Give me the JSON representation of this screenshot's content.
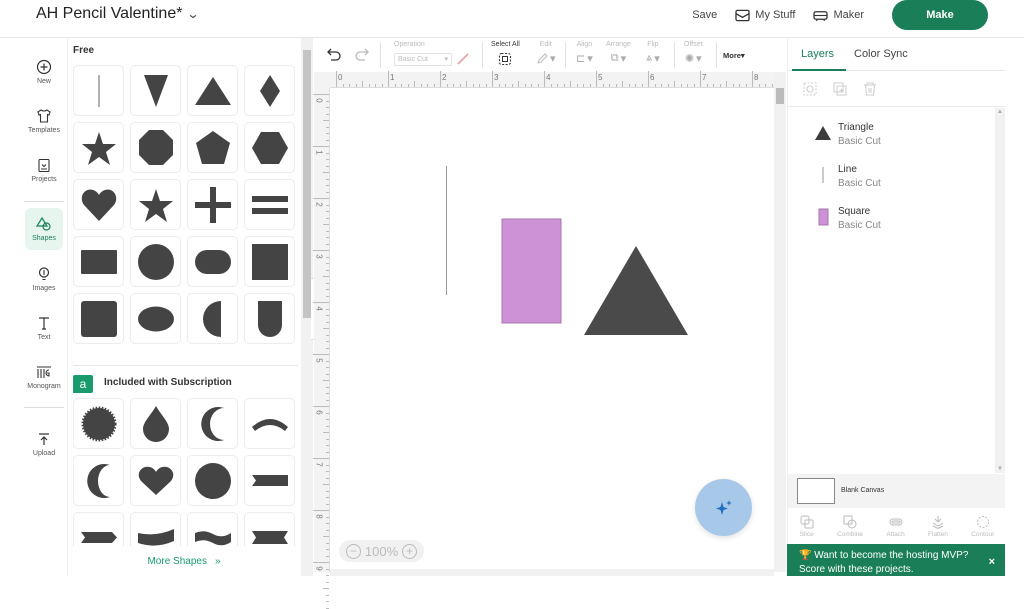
{
  "header": {
    "project_title": "AH Pencil Valentine*",
    "save_label": "Save",
    "my_stuff_label": "My Stuff",
    "maker_label": "Maker",
    "make_label": "Make"
  },
  "leftnav": {
    "items": [
      {
        "label": "New",
        "icon": "plus-circle-icon"
      },
      {
        "label": "Templates",
        "icon": "tshirt-icon"
      },
      {
        "label": "Projects",
        "icon": "projects-icon"
      },
      {
        "label": "Shapes",
        "icon": "shapes-icon",
        "active": true
      },
      {
        "label": "Images",
        "icon": "lightbulb-icon"
      },
      {
        "label": "Text",
        "icon": "text-icon"
      },
      {
        "label": "Monogram",
        "icon": "monogram-icon"
      },
      {
        "label": "Upload",
        "icon": "upload-icon"
      }
    ]
  },
  "shapes_panel": {
    "free_title": "Free",
    "free_shapes": [
      "Line",
      "Inverted Triangle",
      "Triangle",
      "Diamond",
      "Star",
      "Octagon",
      "Pentagon",
      "Hexagon",
      "Heart",
      "Star Small",
      "Plus",
      "Equals",
      "Rectangle",
      "Circle",
      "Rounded Rectangle",
      "Square",
      "Rounded Square",
      "Oval",
      "Half Circle",
      "Shield"
    ],
    "subscription_badge": "a",
    "subscription_title": "Included with Subscription",
    "subscription_shapes": [
      "Seal",
      "Teardrop",
      "Crescent",
      "Arc Banner",
      "Crescent Thin",
      "Heart",
      "Scalloped Circle",
      "Banner",
      "Arrow Banner",
      "Wavy Banner",
      "Wavy Banner 2",
      "Ribbon"
    ],
    "more_shapes_label": "More Shapes",
    "more_shapes_icon": "»"
  },
  "toolbar": {
    "operation_label": "Operation",
    "operation_value": "Basic Cut",
    "select_all_label": "Select All",
    "edit_label": "Edit",
    "align_label": "Align",
    "arrange_label": "Arrange",
    "flip_label": "Flip",
    "offset_label": "Offset",
    "more_label": "More"
  },
  "ruler": {
    "h_labels": [
      "0",
      "1",
      "2",
      "3",
      "4",
      "5",
      "6",
      "7",
      "8"
    ],
    "v_labels": [
      "0",
      "1",
      "2",
      "3",
      "4",
      "5",
      "6",
      "7",
      "8",
      "9"
    ]
  },
  "canvas": {
    "zoom_level": "100%",
    "objects": [
      {
        "name": "Line",
        "color": "#999999"
      },
      {
        "name": "Square",
        "color": "#cd92d6"
      },
      {
        "name": "Triangle",
        "color": "#4a4a4a"
      }
    ]
  },
  "right_panel": {
    "tabs": [
      "Layers",
      "Color Sync"
    ],
    "active_tab": "Layers",
    "layers": [
      {
        "name": "Triangle",
        "operation": "Basic Cut",
        "color": "#3d3d3d"
      },
      {
        "name": "Line",
        "operation": "Basic Cut",
        "color": "#999999"
      },
      {
        "name": "Square",
        "operation": "Basic Cut",
        "color": "#cd92d6"
      }
    ],
    "blank_canvas_label": "Blank Canvas",
    "bottom_tools": [
      "Slice",
      "Combine",
      "Attach",
      "Flatten",
      "Contour"
    ]
  },
  "promo": {
    "icon": "🏆",
    "line1": "Want to become the hosting MVP?",
    "line2": "Score with these projects.",
    "close": "×"
  },
  "colors": {
    "brand_green": "#1a7f59",
    "accent_teal": "#1a9b6e",
    "fab_blue": "#a8c8ea"
  }
}
